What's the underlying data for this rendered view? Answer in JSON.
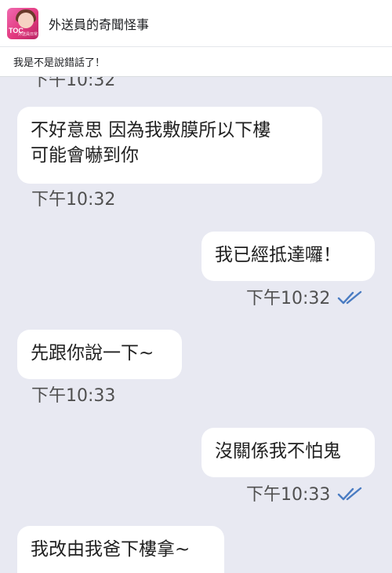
{
  "header": {
    "group_name": "外送員的奇聞怪事",
    "avatar_text": "TOC",
    "avatar_subtext": "外送員日常"
  },
  "post": {
    "caption": "我是不是說錯話了！"
  },
  "colors": {
    "chat_background": "#e8e9f2",
    "bubble": "#ffffff",
    "read_ticks": "#4a7cc2"
  },
  "chat": {
    "clipped_timestamp": "下午10:32",
    "messages": [
      {
        "direction": "incoming",
        "lines": [
          "不好意思 因為我敷膜所以下樓",
          "可能會嚇到你"
        ],
        "time": "下午10:32"
      },
      {
        "direction": "outgoing",
        "lines": [
          "我已經抵達囉！"
        ],
        "time": "下午10:32",
        "read": true
      },
      {
        "direction": "incoming",
        "lines": [
          "先跟你說一下~"
        ],
        "time": "下午10:33"
      },
      {
        "direction": "outgoing",
        "lines": [
          "沒關係我不怕鬼"
        ],
        "time": "下午10:33",
        "read": true
      },
      {
        "direction": "incoming",
        "lines": [
          "我改由我爸下樓拿~"
        ]
      }
    ]
  }
}
